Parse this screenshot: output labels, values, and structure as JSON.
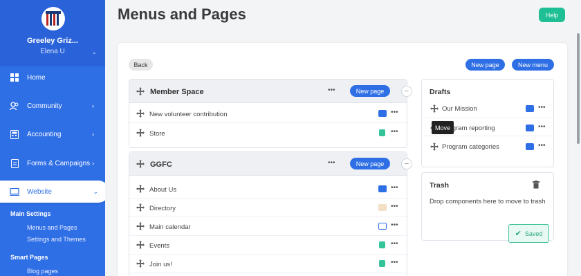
{
  "sidebar": {
    "org_name": "Greeley Griz...",
    "org_user": "Elena U",
    "nav": [
      {
        "label": "Home",
        "icon": "home-icon"
      },
      {
        "label": "Community",
        "icon": "community-icon"
      },
      {
        "label": "Accounting",
        "icon": "accounting-icon"
      },
      {
        "label": "Forms & Campaigns",
        "icon": "forms-icon"
      },
      {
        "label": "Website",
        "icon": "website-icon"
      }
    ],
    "sections": [
      {
        "heading": "Main Settings",
        "links": [
          "Menus and Pages",
          "Settings and Themes"
        ]
      },
      {
        "heading": "Smart Pages",
        "links": [
          "Blog pages"
        ]
      }
    ]
  },
  "header": {
    "title": "Menus and Pages",
    "help": "Help"
  },
  "toolbar": {
    "back": "Back",
    "new_page": "New page",
    "new_menu": "New menu"
  },
  "menus": [
    {
      "title": "Member Space",
      "new_page": "New page",
      "items": [
        {
          "label": "New volunteer contribution",
          "icon": "form-icon"
        },
        {
          "label": "Store",
          "icon": "store-icon"
        }
      ]
    },
    {
      "title": "GGFC",
      "new_page": "New page",
      "items": [
        {
          "label": "About Us",
          "icon": "page-icon"
        },
        {
          "label": "Directory",
          "icon": "directory-icon"
        },
        {
          "label": "Main calendar",
          "icon": "calendar-icon"
        },
        {
          "label": "Events",
          "icon": "events-icon"
        },
        {
          "label": "Join us!",
          "icon": "join-icon"
        }
      ]
    }
  ],
  "drafts": {
    "title": "Drafts",
    "items": [
      {
        "label": "Our Mission",
        "icon": "page-icon"
      },
      {
        "label": "Program reporting",
        "icon": "page-icon"
      },
      {
        "label": "Program categories",
        "icon": "page-icon"
      }
    ]
  },
  "trash": {
    "title": "Trash",
    "text": "Drop components here to move to trash"
  },
  "tooltip": "Move",
  "saved": "Saved",
  "colors": {
    "brand": "#2f6fe6",
    "accent": "#1fbf95",
    "saved": "#3ec29c"
  }
}
